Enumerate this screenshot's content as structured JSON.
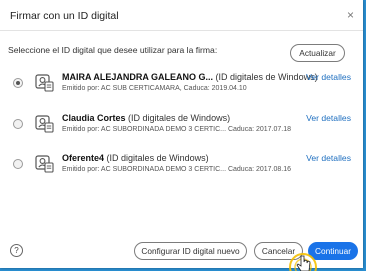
{
  "dialog": {
    "title": "Firmar con un ID digital",
    "close_glyph": "×",
    "instruction": "Seleccione el ID digital que desee utilizar para la firma:",
    "refresh_label": "Actualizar"
  },
  "ids": [
    {
      "name": "MAIRA ALEJANDRA GALEANO G...",
      "type": "(ID digitales de Windows)",
      "details": "Emitido por: AC SUB CERTICAMARA, Caduca: 2019.04.10",
      "link": "Ver detalles",
      "selected": true
    },
    {
      "name": "Claudia Cortes",
      "type": "(ID digitales de Windows)",
      "details": "Emitido por: AC SUBORDINADA DEMO 3 CERTIC... Caduca: 2017.07.18",
      "link": "Ver detalles",
      "selected": false
    },
    {
      "name": "Oferente4",
      "type": "(ID digitales de Windows)",
      "details": "Emitido por: AC SUBORDINADA DEMO 3 CERTIC... Caduca: 2017.08.16",
      "link": "Ver detalles",
      "selected": false
    }
  ],
  "footer": {
    "help_glyph": "?",
    "configure_label": "Configurar ID digital nuevo",
    "cancel_label": "Cancelar",
    "continue_label": "Continuar"
  },
  "colors": {
    "accent": "#1a73e8",
    "link": "#2070c0",
    "background": "#2a8fd2"
  }
}
